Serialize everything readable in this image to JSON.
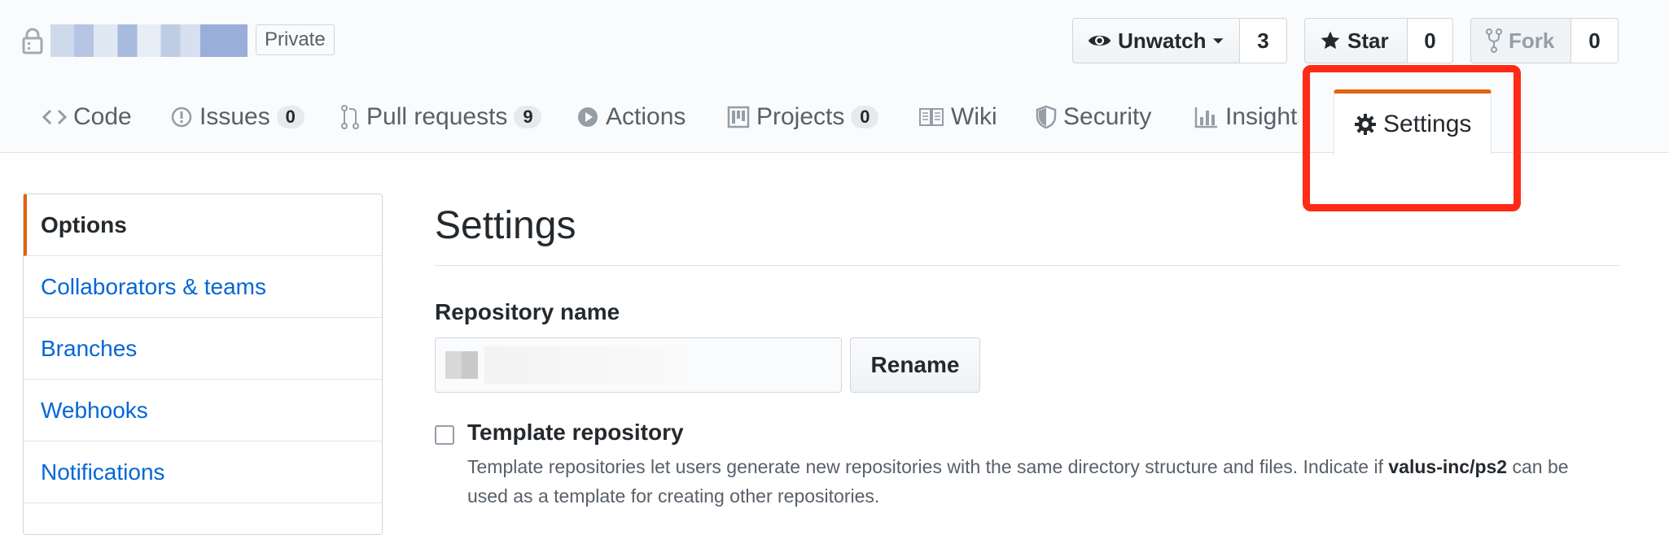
{
  "repo": {
    "visibility_badge": "Private"
  },
  "actions": {
    "unwatch_label": "Unwatch",
    "watch_count": "3",
    "star_label": "Star",
    "star_count": "0",
    "fork_label": "Fork",
    "fork_count": "0"
  },
  "tabs": [
    {
      "label": "Code",
      "icon": "code-icon"
    },
    {
      "label": "Issues",
      "icon": "issue-icon",
      "count": "0"
    },
    {
      "label": "Pull requests",
      "icon": "pull-request-icon",
      "count": "9"
    },
    {
      "label": "Actions",
      "icon": "play-icon"
    },
    {
      "label": "Projects",
      "icon": "project-icon",
      "count": "0"
    },
    {
      "label": "Wiki",
      "icon": "book-icon"
    },
    {
      "label": "Security",
      "icon": "shield-icon"
    },
    {
      "label": "Insights",
      "icon": "graph-icon"
    },
    {
      "label": "Settings",
      "icon": "gear-icon",
      "selected": true
    }
  ],
  "sidebar": {
    "items": [
      {
        "label": "Options",
        "selected": true
      },
      {
        "label": "Collaborators & teams"
      },
      {
        "label": "Branches"
      },
      {
        "label": "Webhooks"
      },
      {
        "label": "Notifications"
      }
    ]
  },
  "main": {
    "title": "Settings",
    "repo_name_label": "Repository name",
    "rename_label": "Rename",
    "template": {
      "label": "Template repository",
      "desc_part1": "Template repositories let users generate new repositories with the same directory structure and files. Indicate if ",
      "desc_bold": "valus-inc/ps2",
      "desc_part2": " can be used as a template for creating other repositories."
    }
  },
  "colors": {
    "accent": "#e36209",
    "link": "#0366d6",
    "highlight_annotation": "#ff2a17"
  }
}
